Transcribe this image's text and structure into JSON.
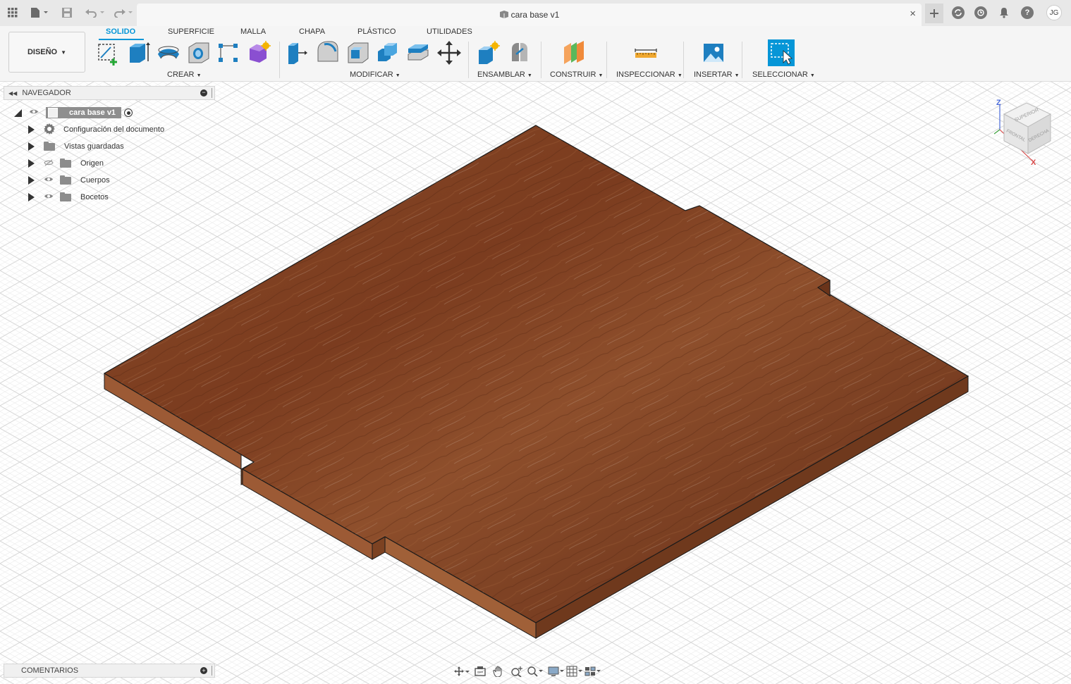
{
  "document": {
    "title": "cara base v1",
    "close_glyph": "×"
  },
  "user": {
    "initials": "JG"
  },
  "topbar_icons": [
    "apps-grid-icon",
    "file-menu-icon",
    "save-icon",
    "undo-icon",
    "redo-icon",
    "new-tab-icon",
    "jobs-status-icon",
    "history-icon",
    "notifications-icon",
    "help-icon"
  ],
  "toolbar": {
    "workspace": "DISEÑO",
    "tabs": [
      {
        "label": "SOLIDO",
        "active": true
      },
      {
        "label": "SUPERFICIE",
        "active": false
      },
      {
        "label": "MALLA",
        "active": false
      },
      {
        "label": "CHAPA",
        "active": false
      },
      {
        "label": "PLÁSTICO",
        "active": false
      },
      {
        "label": "UTILIDADES",
        "active": false
      }
    ],
    "groups": [
      {
        "label": "CREAR",
        "icons": [
          "create-sketch-icon",
          "extrude-icon",
          "revolve-icon",
          "hole-icon",
          "rectangular-pattern-icon",
          "create-form-icon"
        ]
      },
      {
        "label": "MODIFICAR",
        "icons": [
          "press-pull-icon",
          "fillet-icon",
          "shell-icon",
          "combine-icon",
          "offset-face-icon",
          "move-icon"
        ]
      },
      {
        "label": "ENSAMBLAR",
        "icons": [
          "new-component-icon",
          "joint-icon"
        ]
      },
      {
        "label": "CONSTRUIR",
        "icons": [
          "offset-plane-icon"
        ]
      },
      {
        "label": "INSPECCIONAR",
        "icons": [
          "measure-icon"
        ]
      },
      {
        "label": "INSERTAR",
        "icons": [
          "insert-image-icon"
        ]
      },
      {
        "label": "SELECCIONAR",
        "icons": [
          "select-icon"
        ]
      }
    ]
  },
  "browser": {
    "title": "NAVEGADOR",
    "root": "cara base v1",
    "items": [
      {
        "label": "Configuración del documento",
        "icon": "gear-icon"
      },
      {
        "label": "Vistas guardadas",
        "icon": "folder-icon"
      },
      {
        "label": "Origen",
        "icon": "folder-icon",
        "visibility": "hidden"
      },
      {
        "label": "Cuerpos",
        "icon": "folder-icon",
        "visibility": "visible"
      },
      {
        "label": "Bocetos",
        "icon": "folder-icon",
        "visibility": "visible"
      }
    ]
  },
  "comments": {
    "title": "COMENTARIOS"
  },
  "viewcube": {
    "top": "SUPERIOR",
    "front": "FRONTAL",
    "right": "DERECHA",
    "axis_z": "Z",
    "axis_x": "X"
  },
  "navbar_icons": [
    "orbit-icon",
    "look-at-icon",
    "pan-icon",
    "zoom-icon",
    "fit-icon",
    "display-settings-icon",
    "grid-settings-icon",
    "viewports-icon"
  ],
  "colors": {
    "accent": "#0696d7",
    "wood_top": "#7a3e22",
    "wood_side": "#8a4a2a"
  }
}
